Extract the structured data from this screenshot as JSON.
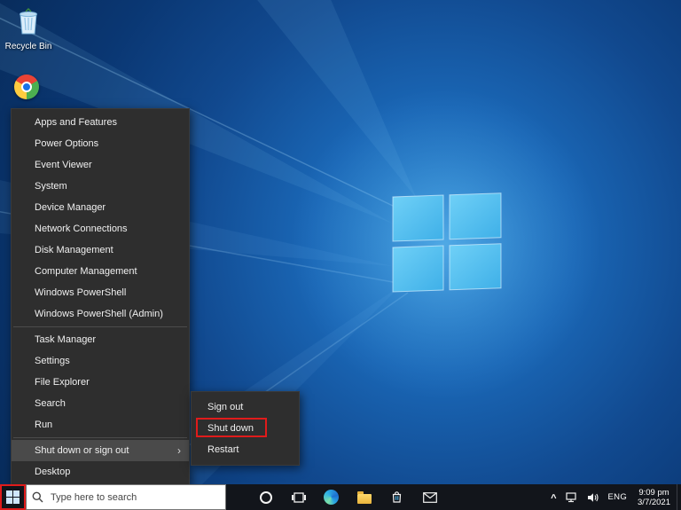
{
  "desktop": {
    "recycle_bin_label": "Recycle Bin"
  },
  "menu": {
    "items": [
      "Apps and Features",
      "Power Options",
      "Event Viewer",
      "System",
      "Device Manager",
      "Network Connections",
      "Disk Management",
      "Computer Management",
      "Windows PowerShell",
      "Windows PowerShell (Admin)",
      "Task Manager",
      "Settings",
      "File Explorer",
      "Search",
      "Run",
      "Shut down or sign out",
      "Desktop"
    ],
    "submenu_arrow": "›"
  },
  "submenu": {
    "items": [
      "Sign out",
      "Shut down",
      "Restart"
    ]
  },
  "taskbar": {
    "search_placeholder": "Type here to search",
    "language": "ENG",
    "time": "9:09 pm",
    "date": "3/7/2021",
    "tray_chevron": "^"
  },
  "colors": {
    "annotation_red": "#e01b1b",
    "wallpaper_blue": "#1a67b6",
    "menu_bg": "#2e2e2e",
    "taskbar_bg": "#12151b"
  }
}
